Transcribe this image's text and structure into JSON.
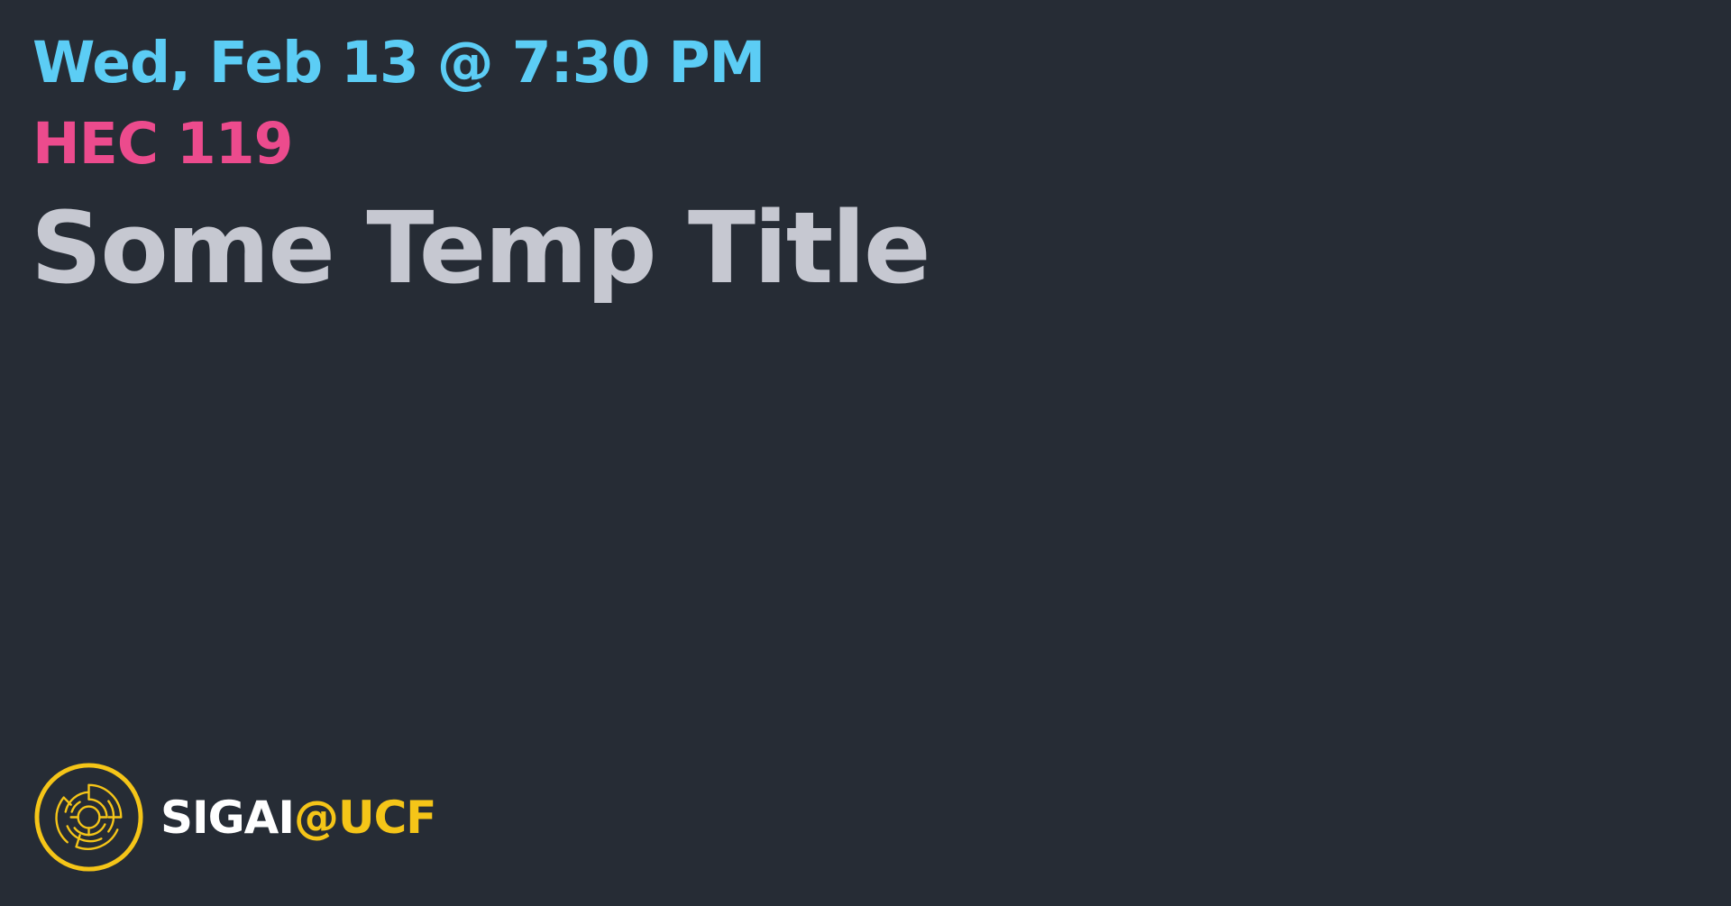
{
  "event": {
    "datetime": "Wed, Feb 13 @ 7:30 PM",
    "location": "HEC 119",
    "title": "Some Temp Title"
  },
  "brand": {
    "name": "SIGAI",
    "suffix": "@UCF",
    "logo_icon": "sigai-circuit-maze-logo-icon"
  },
  "colors": {
    "background": "#262c35",
    "datetime": "#5ccdf5",
    "location": "#ec4b8d",
    "title": "#c6c8d1",
    "brand_name": "#ffffff",
    "accent": "#f5c518"
  }
}
